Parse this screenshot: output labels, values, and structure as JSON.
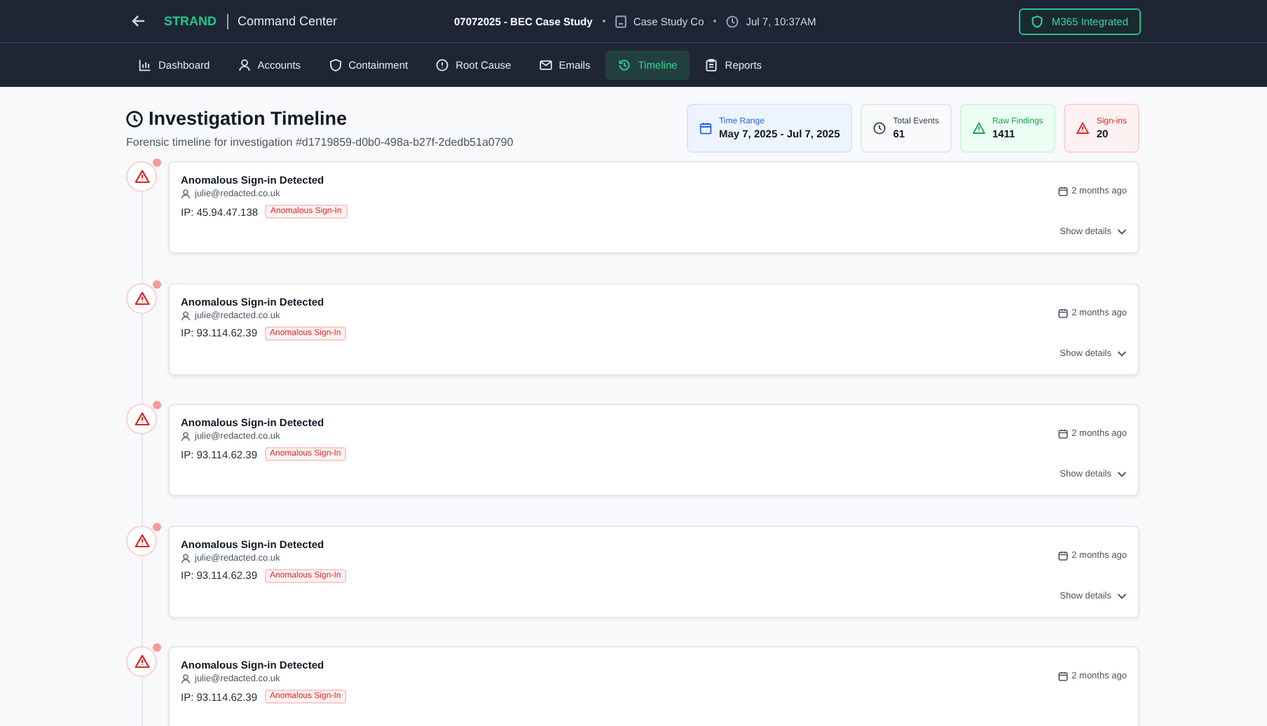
{
  "header": {
    "brand": "STRAND",
    "product": "Command Center",
    "case": "07072025 - BEC Case Study",
    "org": "Case Study Co",
    "time": "Jul 7, 10:37AM",
    "integration": "M365 Integrated"
  },
  "tabs": [
    {
      "label": "Dashboard",
      "kind": "chart",
      "selected": false
    },
    {
      "label": "Accounts",
      "kind": "user",
      "selected": false
    },
    {
      "label": "Containment",
      "kind": "shield",
      "selected": false
    },
    {
      "label": "Root Cause",
      "kind": "alert",
      "selected": false
    },
    {
      "label": "Emails",
      "kind": "mail",
      "selected": false
    },
    {
      "label": "Timeline",
      "kind": "history",
      "selected": true
    },
    {
      "label": "Reports",
      "kind": "report",
      "selected": false
    }
  ],
  "page": {
    "title": "Investigation Timeline",
    "subtitle": "Forensic timeline for investigation #d1719859-d0b0-498a-b27f-2dedb51a0790"
  },
  "stats": [
    {
      "kind": "info",
      "label": "Time Range",
      "value": "May 7, 2025 - Jul 7, 2025"
    },
    {
      "kind": "neutral",
      "label": "Total Events",
      "value": "61"
    },
    {
      "kind": "success",
      "label": "Raw Findings",
      "value": "1411"
    },
    {
      "kind": "danger",
      "label": "Sign-ins",
      "value": "20"
    }
  ],
  "events": [
    {
      "title": "Anomalous Sign-in Detected",
      "user": "julie@redacted.co.uk",
      "ip": "IP: 45.94.47.138",
      "tag": "Anomalous Sign-In",
      "time": "2 months ago",
      "details": "Show details"
    },
    {
      "title": "Anomalous Sign-in Detected",
      "user": "julie@redacted.co.uk",
      "ip": "IP: 93.114.62.39",
      "tag": "Anomalous Sign-In",
      "time": "2 months ago",
      "details": "Show details"
    },
    {
      "title": "Anomalous Sign-in Detected",
      "user": "julie@redacted.co.uk",
      "ip": "IP: 93.114.62.39",
      "tag": "Anomalous Sign-In",
      "time": "2 months ago",
      "details": "Show details"
    },
    {
      "title": "Anomalous Sign-in Detected",
      "user": "julie@redacted.co.uk",
      "ip": "IP: 93.114.62.39",
      "tag": "Anomalous Sign-In",
      "time": "2 months ago",
      "details": "Show details"
    },
    {
      "title": "Anomalous Sign-in Detected",
      "user": "julie@redacted.co.uk",
      "ip": "IP: 93.114.62.39",
      "tag": "Anomalous Sign-In",
      "time": "2 months ago"
    }
  ]
}
